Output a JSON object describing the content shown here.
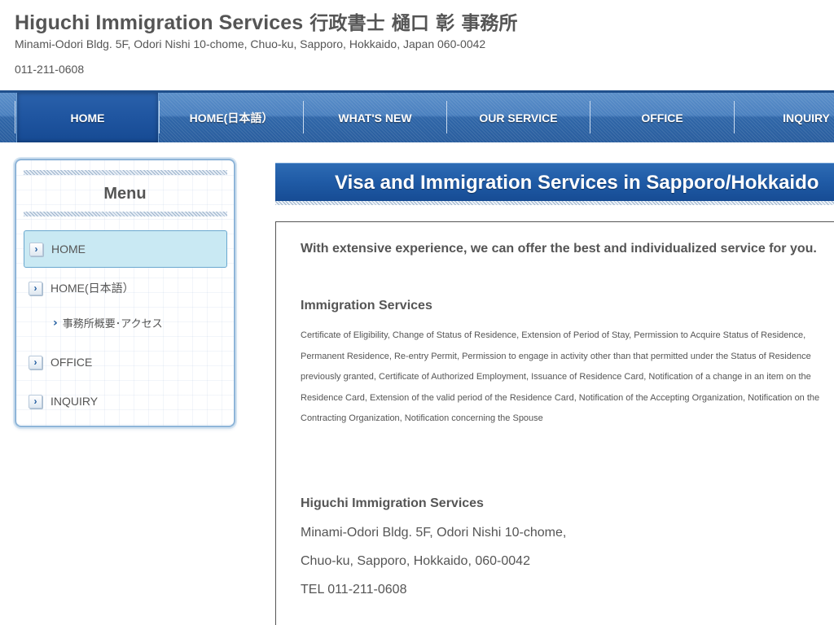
{
  "header": {
    "title": "Higuchi Immigration Services",
    "title_jp": "行政書士 樋口 彰 事務所",
    "address": "Minami-Odori Bldg. 5F, Odori Nishi 10-chome, Chuo-ku, Sapporo, Hokkaido, Japan 060-0042",
    "phone": "011-211-0608"
  },
  "nav": {
    "items": [
      {
        "label": "HOME"
      },
      {
        "label": "HOME(日本語）"
      },
      {
        "label": "WHAT'S NEW"
      },
      {
        "label": "OUR SERVICE"
      },
      {
        "label": "OFFICE"
      },
      {
        "label": "INQUIRY"
      }
    ],
    "active_index": 0
  },
  "sidebar": {
    "title": "Menu",
    "items": [
      {
        "label": "HOME",
        "icon": "chevron-right-icon"
      },
      {
        "label": "HOME(日本語）",
        "icon": "chevron-right-icon"
      },
      {
        "label": "OFFICE",
        "icon": "chevron-right-icon"
      },
      {
        "label": "INQUIRY",
        "icon": "chevron-right-icon"
      }
    ],
    "subitem": {
      "label": "事務所概要･アクセス"
    }
  },
  "main": {
    "heading": "Visa and Immigration Services in Sapporo/Hokkaido",
    "lead": "With extensive experience, we can offer the best and individualized service for you.",
    "services_title": "Immigration Services",
    "services_text": "Certificate of Eligibility, Change of Status of Residence, Extension of Period of Stay, Permission to Acquire Status of Residence, Permanent Residence, Re-entry Permit, Permission to engage in activity other than that permitted under the Status of Residence previously granted, Certificate of Authorized Employment, Issuance of Residence Card, Notification of a change in an item on the Residence Card, Extension of the valid period of the Residence Card, Notification of the Accepting Organization, Notification on the Contracting Organization, Notification concerning the Spouse",
    "office_title": "Higuchi Immigration Services",
    "office_address_1": "Minami-Odori Bldg. 5F, Odori Nishi 10-chome,",
    "office_address_2": "Chuo-ku, Sapporo, Hokkaido, 060-0042",
    "office_tel": "TEL 011-211-0608"
  },
  "colors": {
    "nav_blue": "#3f78b8",
    "nav_active": "#1f55a0",
    "menu_active_bg": "#c9e9f3",
    "text": "#555555"
  }
}
